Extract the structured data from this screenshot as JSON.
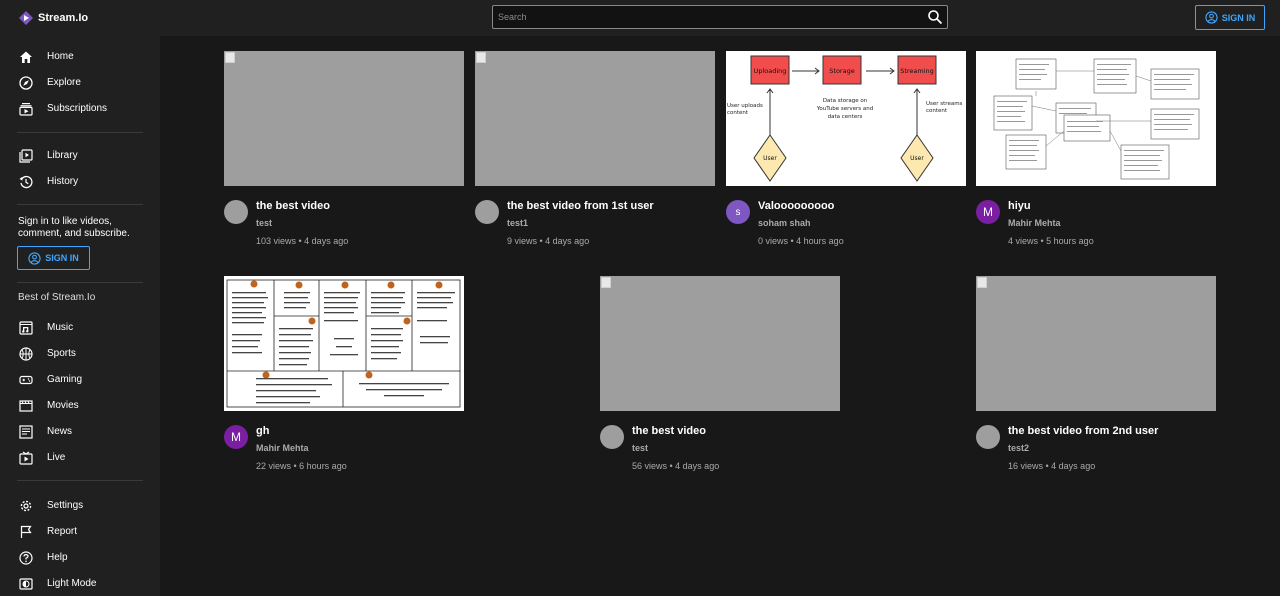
{
  "app": {
    "name": "Stream.Io"
  },
  "search": {
    "placeholder": "Search"
  },
  "header": {
    "signin_label": "SIGN IN"
  },
  "sidebar": {
    "primary": [
      {
        "label": "Home",
        "icon": "home-icon"
      },
      {
        "label": "Explore",
        "icon": "compass-icon"
      },
      {
        "label": "Subscriptions",
        "icon": "subscriptions-icon"
      }
    ],
    "library": [
      {
        "label": "Library",
        "icon": "library-icon"
      },
      {
        "label": "History",
        "icon": "history-icon"
      }
    ],
    "signin_prompt": "Sign in to like videos, comment, and subscribe.",
    "signin_label": "SIGN IN",
    "best_title": "Best of Stream.Io",
    "best": [
      {
        "label": "Music",
        "icon": "music-icon"
      },
      {
        "label": "Sports",
        "icon": "sports-icon"
      },
      {
        "label": "Gaming",
        "icon": "gaming-icon"
      },
      {
        "label": "Movies",
        "icon": "movies-icon"
      },
      {
        "label": "News",
        "icon": "news-icon"
      },
      {
        "label": "Live",
        "icon": "live-icon"
      }
    ],
    "settings": [
      {
        "label": "Settings",
        "icon": "gear-icon"
      },
      {
        "label": "Report",
        "icon": "flag-icon"
      },
      {
        "label": "Help",
        "icon": "help-icon"
      },
      {
        "label": "Light Mode",
        "icon": "light-mode-icon"
      }
    ]
  },
  "videos": [
    {
      "title": "the best video",
      "channel": "test",
      "stats": "103 views • 4 days ago",
      "avatar": "",
      "thumbnail": "broken"
    },
    {
      "title": "the best video from 1st user",
      "channel": "test1",
      "stats": "9 views • 4 days ago",
      "avatar": "",
      "thumbnail": "broken"
    },
    {
      "title": "Valooooooooo",
      "channel": "soham shah",
      "stats": "0 views • 4 hours ago",
      "avatar": "s",
      "thumbnail": "flow-diagram",
      "diagram": {
        "boxes": [
          "Uploading",
          "Storage",
          "Streaming"
        ],
        "note_left": "User uploads content",
        "note_mid": "Data storage on YouTube servers and data centers",
        "note_right": "User streams content",
        "diamond": "User"
      }
    },
    {
      "title": "hiyu",
      "channel": "Mahir Mehta",
      "stats": "4 views • 5 hours ago",
      "avatar": "M",
      "thumbnail": "uml-diagram"
    },
    {
      "title": "gh",
      "channel": "Mahir Mehta",
      "stats": "22 views • 6 hours ago",
      "avatar": "M",
      "thumbnail": "business-canvas"
    },
    {
      "title": "the best video",
      "channel": "test",
      "stats": "56 views • 4 days ago",
      "avatar": "",
      "thumbnail": "broken"
    },
    {
      "title": "the best video from 2nd user",
      "channel": "test2",
      "stats": "16 views • 4 days ago",
      "avatar": "",
      "thumbnail": "broken"
    }
  ],
  "colors": {
    "accent": "#3ea6ff",
    "avatar_purple": "#7b1fa2",
    "avatar_violet": "#7e57c2",
    "thumb_placeholder": "#9e9e9e",
    "diagram_red": "#f24d4d",
    "diagram_yellow": "#fde8b0"
  }
}
